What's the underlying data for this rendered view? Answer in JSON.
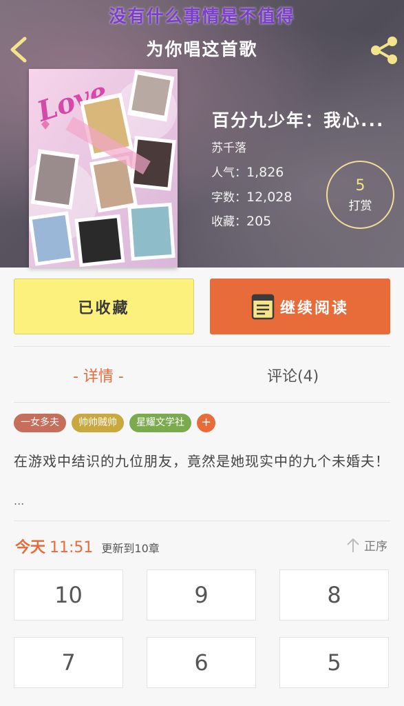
{
  "banner": {
    "text": "没有什么事情是不值得"
  },
  "nav": {
    "title": "为你唱这首歌",
    "back_icon": "chevron-left-icon",
    "share_icon": "share-icon"
  },
  "cover": {
    "love_text": "Love"
  },
  "book": {
    "title": "百分九少年：我心...",
    "author": "苏千落",
    "popularity_label": "人气：",
    "popularity": "1,826",
    "words_label": "字数：",
    "words": "12,028",
    "favorites_label": "收藏：",
    "favorites": "205"
  },
  "reward": {
    "count": "5",
    "label": "打赏"
  },
  "actions": {
    "collected_label": "已收藏",
    "read_label": "继续阅读"
  },
  "tabs": {
    "detail": "- 详情 -",
    "comments": "评论(4)"
  },
  "tags": [
    {
      "label": "一女多夫",
      "color": "#c56e5c"
    },
    {
      "label": "帅帅贼帅",
      "color": "#c9a83e"
    },
    {
      "label": "星耀文学社",
      "color": "#7cab4f"
    }
  ],
  "tag_add_label": "+",
  "synopsis": "在游戏中结识的九位朋友，竟然是她现实中的九个未婚夫！",
  "synopsis_more": "...",
  "update": {
    "today": "今天",
    "time": "11:51",
    "text": "更新到10章"
  },
  "sort": {
    "label": "正序"
  },
  "chapters": [
    "10",
    "9",
    "8",
    "7",
    "6",
    "5"
  ],
  "colors": {
    "accent": "#e86b3a",
    "collected_bg": "#fbf17c",
    "reward_gold": "#f3e38a"
  }
}
